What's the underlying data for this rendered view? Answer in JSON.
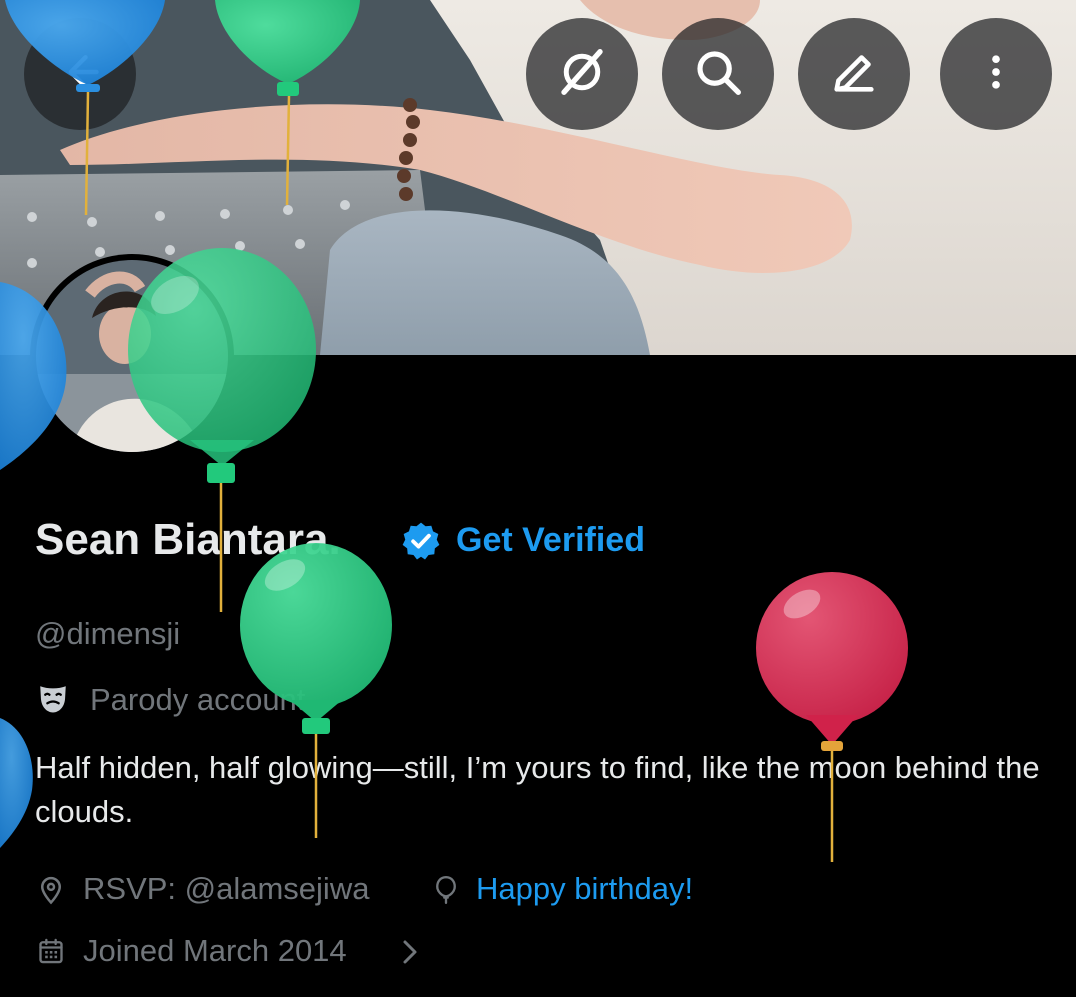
{
  "header": {
    "back_icon": "arrow-left-icon",
    "actions": [
      {
        "icon": "grok-icon"
      },
      {
        "icon": "search-icon"
      },
      {
        "icon": "edit-icon"
      },
      {
        "icon": "more-vertical-icon"
      }
    ]
  },
  "profile": {
    "display_name": "Sean Biantara.",
    "verified_icon": "verified-badge-icon",
    "get_verified_label": "Get Verified",
    "handle": "@dimensji",
    "parody_icon": "theater-mask-icon",
    "parody_label": "Parody account",
    "bio": "Half hidden, half glowing—still, I’m yours to find, like the moon behind the clouds.",
    "location_icon": "location-pin-icon",
    "location": "RSVP: @alamsejiwa",
    "birthday_icon": "balloon-icon",
    "birthday": "Happy birthday!",
    "joined_icon": "calendar-icon",
    "joined": "Joined March 2014",
    "joined_chevron_icon": "chevron-right-icon"
  },
  "colors": {
    "accent": "#1d9bf0",
    "secondary_text": "#71767b",
    "primary_text": "#e7e9ea",
    "balloon_green": "#22c97c",
    "balloon_blue": "#1d8fe0",
    "balloon_red": "#dc2f55"
  }
}
